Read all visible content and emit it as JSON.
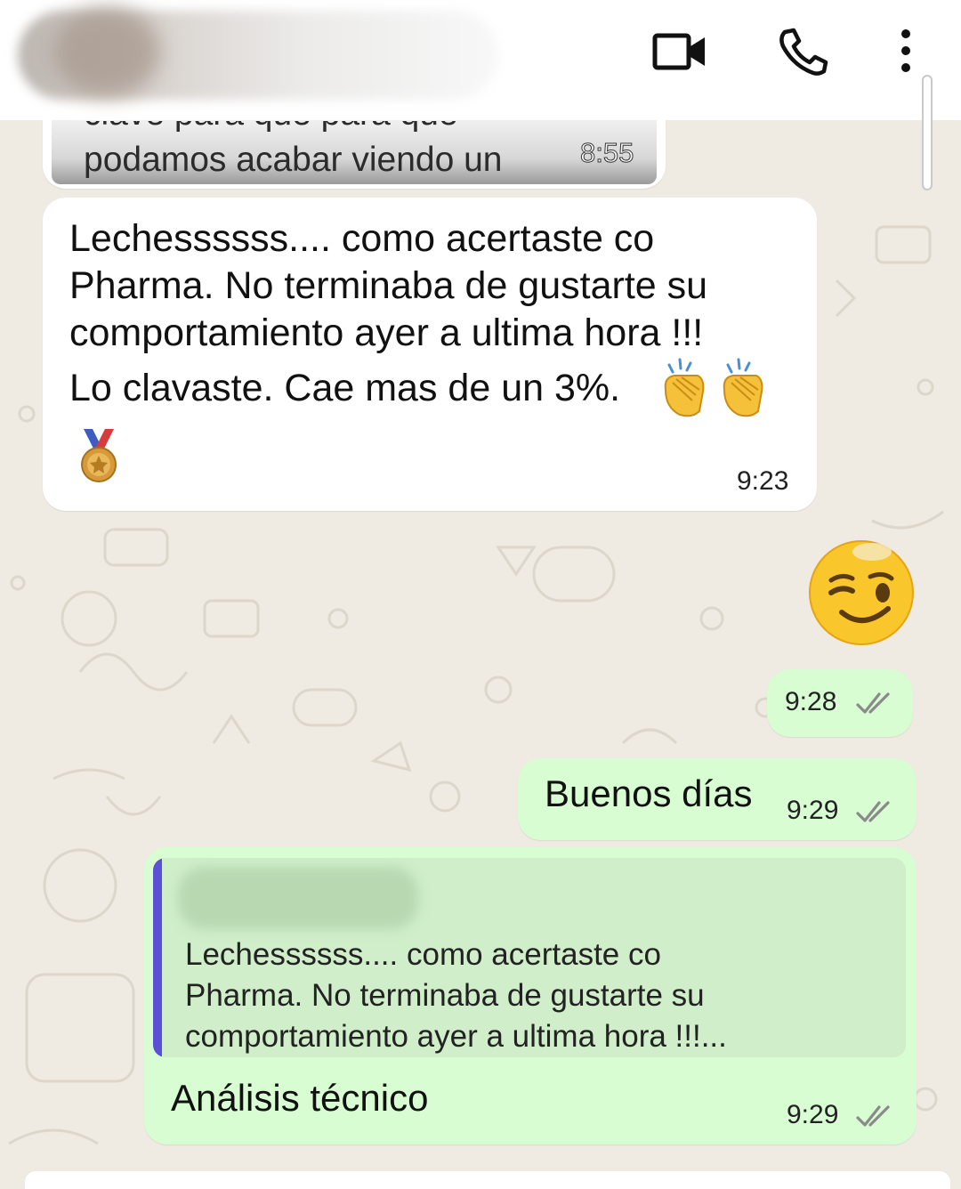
{
  "header": {
    "contact_name": "",
    "icons": [
      "video-call-icon",
      "voice-call-icon",
      "more-options-icon"
    ]
  },
  "messages": {
    "prev": {
      "cut_line": "clave para que para que",
      "text": "podamos acabar viendo un",
      "time": "8:55"
    },
    "msg1": {
      "lines": [
        "Lechessssss.... como acertaste co",
        "Pharma. No terminaba de gustarte su",
        "comportamiento ayer a ultima hora !!!"
      ],
      "line4": "Lo clavaste. Cae mas de un 3%.",
      "emojis": [
        "clapping-hands-icon",
        "clapping-hands-icon",
        "medal-icon"
      ],
      "time": "9:23"
    },
    "wink": {
      "emoji": "winking-face-icon",
      "time": "9:28"
    },
    "buenos_dias": {
      "text": "Buenos días",
      "time": "9:29"
    },
    "reply": {
      "quoted_author": "",
      "quoted_lines": [
        "Lechessssss.... como acertaste co",
        "Pharma. No terminaba de gustarte su",
        "comportamiento ayer a ultima hora !!!..."
      ],
      "text": "Análisis técnico",
      "time": "9:29"
    }
  },
  "colors": {
    "wallpaper": "#efeae2",
    "incoming": "#ffffff",
    "outgoing": "#d9fdd3",
    "quote_bar": "#5b4fd6"
  }
}
